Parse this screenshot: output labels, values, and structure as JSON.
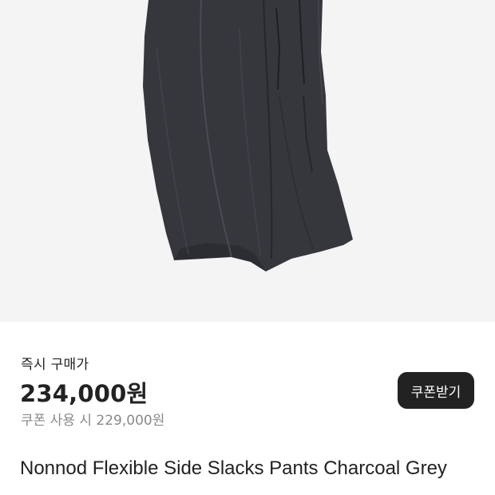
{
  "product": {
    "image_alt": "charcoal grey wide slacks",
    "title": "Nonnod Flexible Side Slacks Pants Charcoal Grey"
  },
  "pricing": {
    "label": "즉시 구매가",
    "price": "234,000원",
    "coupon_price": "쿠폰 사용 시 229,000원",
    "coupon_button_label": "쿠폰받기"
  },
  "colors": {
    "image_background": "#f4f4f4",
    "pants": "#35373d",
    "button_background": "#222222",
    "muted_text": "#8a8a8a"
  }
}
